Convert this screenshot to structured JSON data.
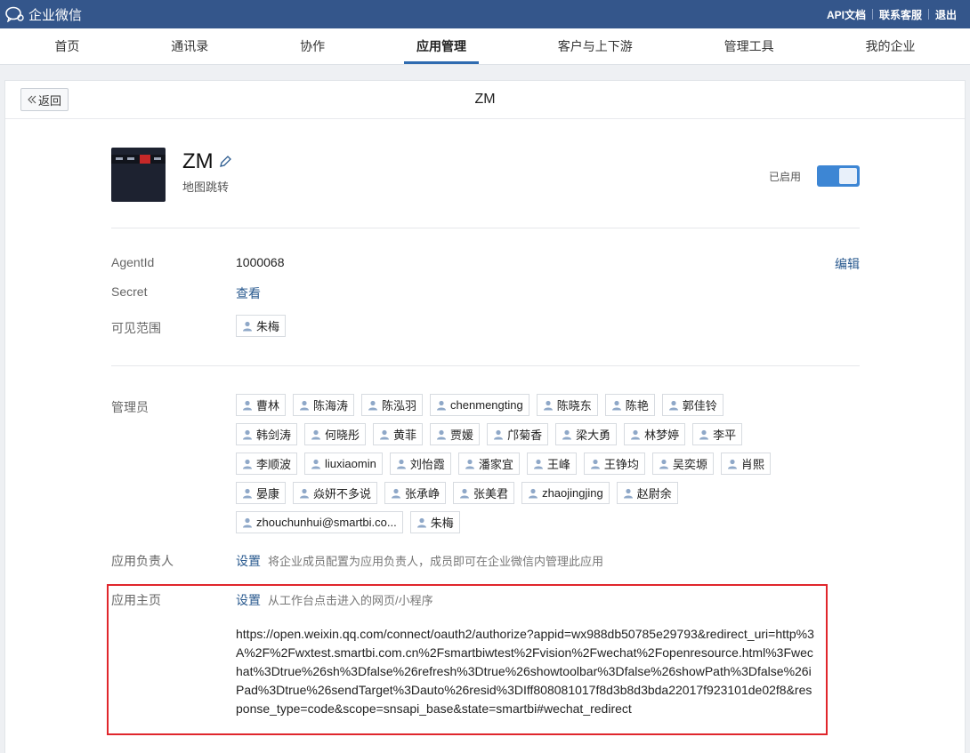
{
  "topbar": {
    "brand": "企业微信",
    "links": [
      "API文档",
      "联系客服",
      "退出"
    ]
  },
  "nav": {
    "items": [
      "首页",
      "通讯录",
      "协作",
      "应用管理",
      "客户与上下游",
      "管理工具",
      "我的企业"
    ],
    "active_index": 3
  },
  "panel": {
    "back_label": "返回",
    "title": "ZM"
  },
  "app": {
    "name": "ZM",
    "description": "地图跳转",
    "status_label": "已启用",
    "enabled": true
  },
  "details": {
    "agentid_label": "AgentId",
    "agentid_value": "1000068",
    "edit_label": "编辑",
    "secret_label": "Secret",
    "secret_action": "查看",
    "visibility_label": "可见范围",
    "visibility_tags": [
      "朱梅"
    ]
  },
  "admins": {
    "label": "管理员",
    "tags": [
      "曹林",
      "陈海涛",
      "陈泓羽",
      "chenmengting",
      "陈晓东",
      "陈艳",
      "郭佳铃",
      "韩剑涛",
      "何晓彤",
      "黄菲",
      "贾媛",
      "邝菊香",
      "梁大勇",
      "林梦婷",
      "李平",
      "李顺波",
      "liuxiaomin",
      "刘怡霞",
      "潘家宜",
      "王峰",
      "王铮均",
      "吴奕塬",
      "肖熙",
      "晏康",
      "焱妍不多说",
      "张承峥",
      "张美君",
      "zhaojingjing",
      "赵尉余",
      "zhouchunhui@smartbi.co...",
      "朱梅"
    ]
  },
  "owner": {
    "label": "应用负责人",
    "action": "设置",
    "hint": "将企业成员配置为应用负责人，成员即可在企业微信内管理此应用"
  },
  "homepage": {
    "label": "应用主页",
    "action": "设置",
    "hint": "从工作台点击进入的网页/小程序",
    "url": "https://open.weixin.qq.com/connect/oauth2/authorize?appid=wx988db50785e29793&redirect_uri=http%3A%2F%2Fwxtest.smartbi.com.cn%2Fsmartbiwtest%2Fvision%2Fwechat%2Fopenresource.html%3Fwechat%3Dtrue%26sh%3Dfalse%26refresh%3Dtrue%26showtoolbar%3Dfalse%26showPath%3Dfalse%26iPad%3Dtrue%26sendTarget%3Dauto%26resid%3DIff808081017f8d3b8d3bda22017f923101de02f8&response_type=code&scope=snsapi_base&state=smartbi#wechat_redirect"
  }
}
